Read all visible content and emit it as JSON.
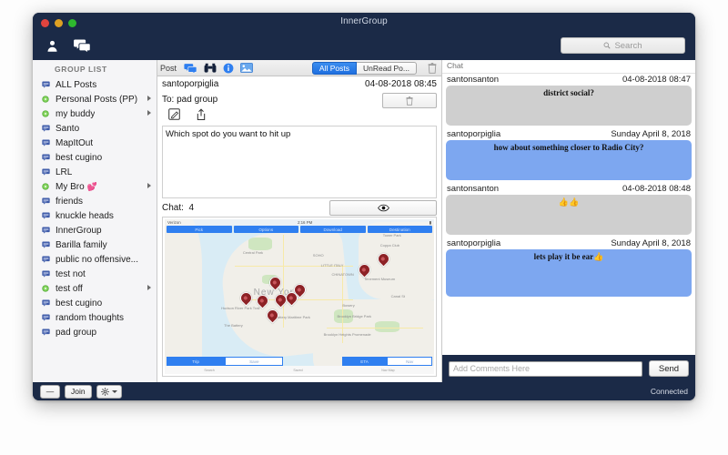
{
  "window": {
    "title": "InnerGroup",
    "traffic_lights": [
      "close-red",
      "minimize-yellow",
      "zoom-green"
    ]
  },
  "app_toolbar": {
    "icons": [
      "person-icon",
      "chat-bubbles-icon"
    ],
    "search": {
      "placeholder": "Search",
      "icon": "search-icon"
    }
  },
  "sidebar": {
    "title": "GROUP LIST",
    "items": [
      {
        "label": "ALL Posts",
        "icon": "chat-bubble-icon",
        "arrow": false
      },
      {
        "label": "Personal Posts (PP)",
        "icon": "green-dot-icon",
        "arrow": true
      },
      {
        "label": "my buddy",
        "icon": "green-dot-icon",
        "arrow": true
      },
      {
        "label": "Santo",
        "icon": "chat-bubble-icon",
        "arrow": false
      },
      {
        "label": "MapItOut",
        "icon": "chat-bubble-icon",
        "arrow": false
      },
      {
        "label": "best cugino",
        "icon": "chat-bubble-icon",
        "arrow": false
      },
      {
        "label": "LRL",
        "icon": "chat-bubble-icon",
        "arrow": false
      },
      {
        "label": "My Bro",
        "emoji": "💕",
        "icon": "green-dot-icon",
        "arrow": true
      },
      {
        "label": "friends",
        "icon": "chat-bubble-icon",
        "arrow": false
      },
      {
        "label": "knuckle heads",
        "icon": "chat-bubble-icon",
        "arrow": false
      },
      {
        "label": "InnerGroup",
        "icon": "chat-bubble-icon",
        "arrow": false
      },
      {
        "label": "Barilla family",
        "icon": "chat-bubble-icon",
        "arrow": false
      },
      {
        "label": "public no offensive...",
        "icon": "chat-bubble-icon",
        "arrow": false
      },
      {
        "label": "test not",
        "icon": "chat-bubble-icon",
        "arrow": false
      },
      {
        "label": "test off",
        "icon": "green-dot-icon",
        "arrow": true
      },
      {
        "label": "best cugino",
        "icon": "chat-bubble-icon",
        "arrow": false
      },
      {
        "label": "random thoughts",
        "icon": "chat-bubble-icon",
        "arrow": false
      },
      {
        "label": "pad group",
        "icon": "chat-bubble-icon",
        "arrow": false
      }
    ]
  },
  "post_pane": {
    "toolbar": {
      "label": "Post",
      "icons": [
        "chat-bubbles-icon",
        "binoculars-icon",
        "info-circle-icon",
        "image-icon"
      ],
      "filter_all": "All Posts",
      "filter_unread": "UnRead Po...",
      "trash_icon": "trash-icon",
      "selected_filter": "All Posts"
    },
    "author": "santoporpiglia",
    "timestamp": "04-08-2018 08:45",
    "to_label": "To: pad group",
    "delete_icon": "trash-icon",
    "actions": [
      "compose-icon",
      "share-icon"
    ],
    "message": "Which spot do you want to hit up",
    "chat_count_label": "Chat:",
    "chat_count": "4",
    "eye_icon": "eye-icon"
  },
  "map": {
    "status_left": "Verizon",
    "status_center": "2:16 PM",
    "status_right": "",
    "top_buttons": [
      "Pick",
      "Options",
      "Download",
      "Destination"
    ],
    "bottom_left": [
      "Trip",
      "Save"
    ],
    "bottom_right": [
      "ETA",
      "Nav"
    ],
    "city_label": "New York",
    "labels": [
      "Central Park",
      "LITTLE ITALY",
      "CHINATOWN",
      "SOHO",
      "Tenement Museum",
      "Brooklyn Bridge Park",
      "Brooklyn Heights Promenade",
      "Hudson River Park Trail",
      "The Battery",
      "Battery Maritime Park",
      "Canal St",
      "Bowery",
      "Coppa Club",
      "Tower Park",
      "COBBLE HILL"
    ],
    "pin_count": 9,
    "tab_labels": [
      "Search",
      "Saved",
      "Nav Map"
    ]
  },
  "chat_pane": {
    "header": "Chat",
    "messages": [
      {
        "author": "santonsanton",
        "time": "04-08-2018 08:47",
        "text": "district social?",
        "style": "gray"
      },
      {
        "author": "santoporpiglia",
        "time": "Sunday April 8, 2018",
        "text": "how about something closer to Radio City?",
        "style": "blue"
      },
      {
        "author": "santonsanton",
        "time": "04-08-2018 08:48",
        "text": "👍👍",
        "style": "gray"
      },
      {
        "author": "santoporpiglia",
        "time": "Sunday April 8, 2018",
        "text": "lets play it be ear👍",
        "style": "blue"
      }
    ],
    "input_placeholder": "Add Comments Here",
    "send_label": "Send"
  },
  "bottom_bar": {
    "minus_label": "—",
    "join_label": "Join",
    "gear_icon": "gear-icon",
    "status": "Connected"
  },
  "colors": {
    "chrome": "#1b2a47",
    "accent_blue": "#2f7ff0",
    "bubble_blue": "#7da7f0",
    "bubble_gray": "#cfcfcf",
    "sidebar_bg": "#f5f5f7",
    "green_dot": "#6cc24a"
  }
}
